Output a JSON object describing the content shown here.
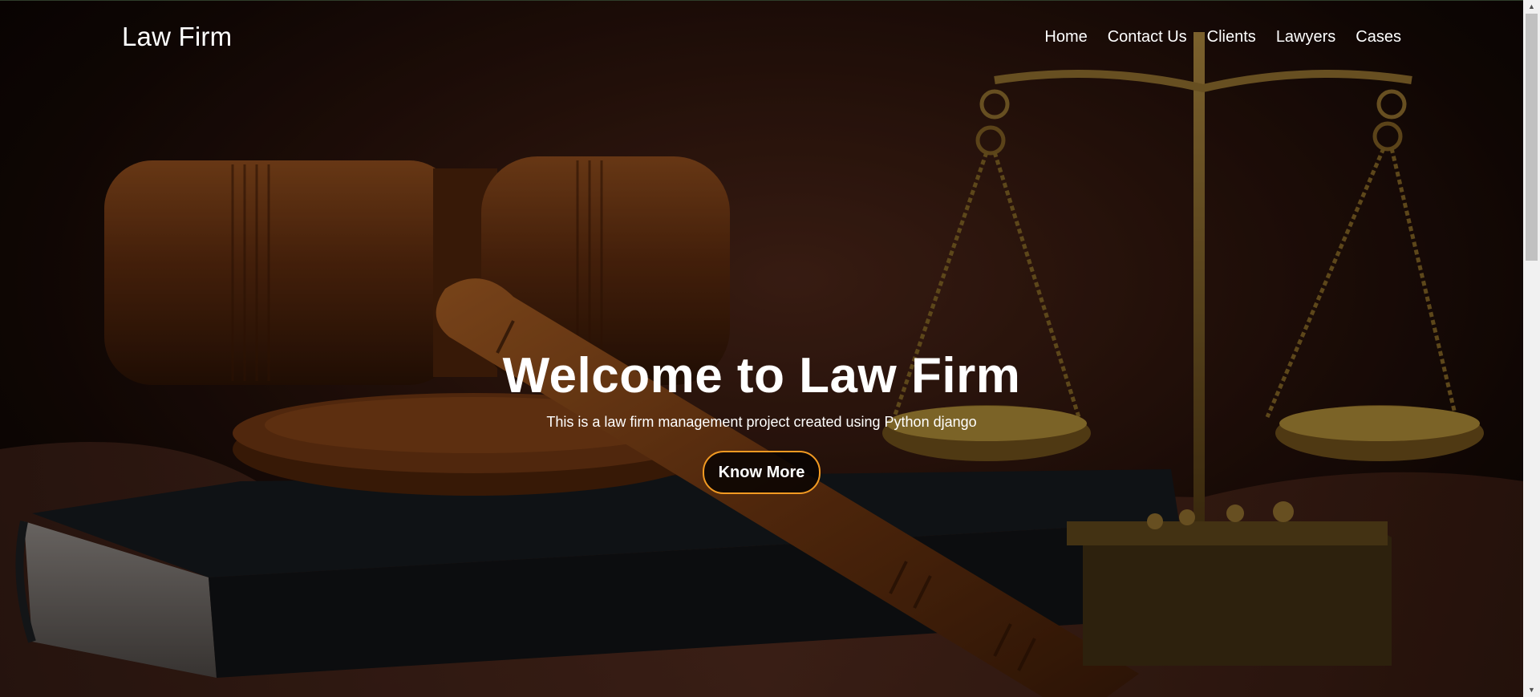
{
  "navbar": {
    "brand": "Law Firm",
    "links": [
      {
        "label": "Home"
      },
      {
        "label": "Contact Us"
      },
      {
        "label": "Clients"
      },
      {
        "label": "Lawyers"
      },
      {
        "label": "Cases"
      }
    ]
  },
  "hero": {
    "title": "Welcome to Law Firm",
    "subtitle": "This is a law firm management project created using Python django",
    "button_label": "Know More",
    "background_image": "gavel-and-scales-of-justice-photo",
    "accent_color": "#f29a22"
  },
  "scrollbar": {
    "up_icon": "scroll-up-arrow-icon",
    "down_icon": "scroll-down-arrow-icon"
  }
}
